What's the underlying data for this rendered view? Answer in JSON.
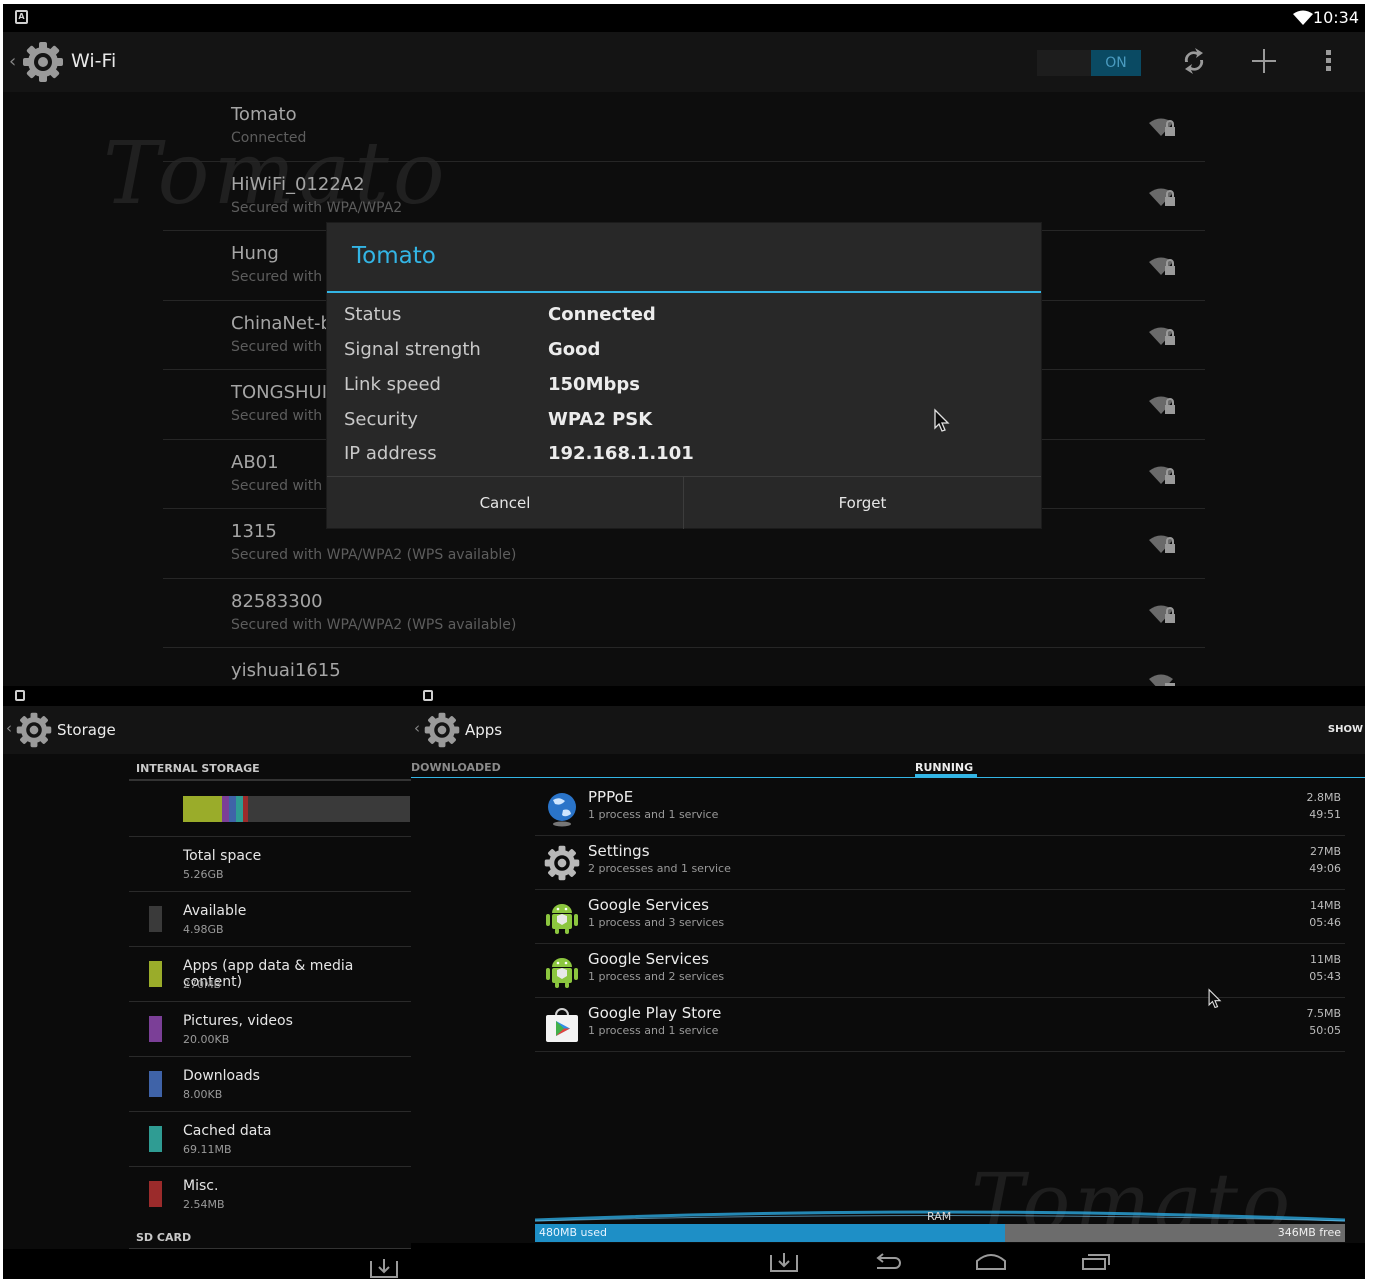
{
  "statusbar": {
    "time": "10:34"
  },
  "wifi": {
    "title": "Wi-Fi",
    "toggle": "ON",
    "watermark": "Tomato",
    "networks": [
      {
        "ssid": "Tomato",
        "status": "Connected"
      },
      {
        "ssid": "HiWiFi_0122A2",
        "status": "Secured with WPA/WPA2"
      },
      {
        "ssid": "Hung",
        "status": "Secured with W"
      },
      {
        "ssid": "ChinaNet-b",
        "status": "Secured with W"
      },
      {
        "ssid": "TONGSHUI",
        "status": "Secured with W"
      },
      {
        "ssid": "AB01",
        "status": "Secured with W"
      },
      {
        "ssid": "1315",
        "status": "Secured with WPA/WPA2 (WPS available)"
      },
      {
        "ssid": "82583300",
        "status": "Secured with WPA/WPA2 (WPS available)"
      },
      {
        "ssid": "yishuai1615",
        "status": ""
      }
    ]
  },
  "dialog": {
    "title": "Tomato",
    "rows": [
      {
        "label": "Status",
        "value": "Connected"
      },
      {
        "label": "Signal strength",
        "value": "Good"
      },
      {
        "label": "Link speed",
        "value": "150Mbps"
      },
      {
        "label": "Security",
        "value": "WPA2 PSK"
      },
      {
        "label": "IP address",
        "value": "192.168.1.101"
      }
    ],
    "cancel": "Cancel",
    "forget": "Forget"
  },
  "storage": {
    "title": "Storage",
    "section_internal": "INTERNAL STORAGE",
    "section_sd": "SD CARD",
    "bar": [
      {
        "color": "#9aac2a",
        "fraction": 0.17
      },
      {
        "color": "#7b3f97",
        "fraction": 0.03
      },
      {
        "color": "#3f63a8",
        "fraction": 0.03
      },
      {
        "color": "#2f9c93",
        "fraction": 0.03
      },
      {
        "color": "#9b2b2b",
        "fraction": 0.02
      }
    ],
    "items": [
      {
        "name": "Total space",
        "size": "5.26GB",
        "color": ""
      },
      {
        "name": "Available",
        "size": "4.98GB",
        "color": "#3a3a3a"
      },
      {
        "name": "Apps (app data & media content)",
        "size": "270MB",
        "color": "#9aac2a"
      },
      {
        "name": "Pictures, videos",
        "size": "20.00KB",
        "color": "#7b3f97"
      },
      {
        "name": "Downloads",
        "size": "8.00KB",
        "color": "#3f63a8"
      },
      {
        "name": "Cached data",
        "size": "69.11MB",
        "color": "#2f9c93"
      },
      {
        "name": "Misc.",
        "size": "2.54MB",
        "color": "#9b2b2b"
      }
    ]
  },
  "apps": {
    "title": "Apps",
    "show_label": "SHOW",
    "tab_downloaded": "DOWNLOADED",
    "tab_running": "RUNNING",
    "running": [
      {
        "name": "PPPoE",
        "desc": "1 process and 1 service",
        "mem": "2.8MB",
        "time": "49:51",
        "icon": "globe-icon"
      },
      {
        "name": "Settings",
        "desc": "2 processes and 1 service",
        "mem": "27MB",
        "time": "49:06",
        "icon": "gear-icon"
      },
      {
        "name": "Google Services",
        "desc": "1 process and 3 services",
        "mem": "14MB",
        "time": "05:46",
        "icon": "android-icon"
      },
      {
        "name": "Google Services",
        "desc": "1 process and 2 services",
        "mem": "11MB",
        "time": "05:43",
        "icon": "android-icon"
      },
      {
        "name": "Google Play Store",
        "desc": "1 process and 1 service",
        "mem": "7.5MB",
        "time": "50:05",
        "icon": "play-store-icon"
      }
    ],
    "ram_label": "RAM",
    "ram_used": "480MB used",
    "ram_free": "346MB free",
    "ram_used_fraction": 0.58,
    "watermark": "Tomato"
  }
}
